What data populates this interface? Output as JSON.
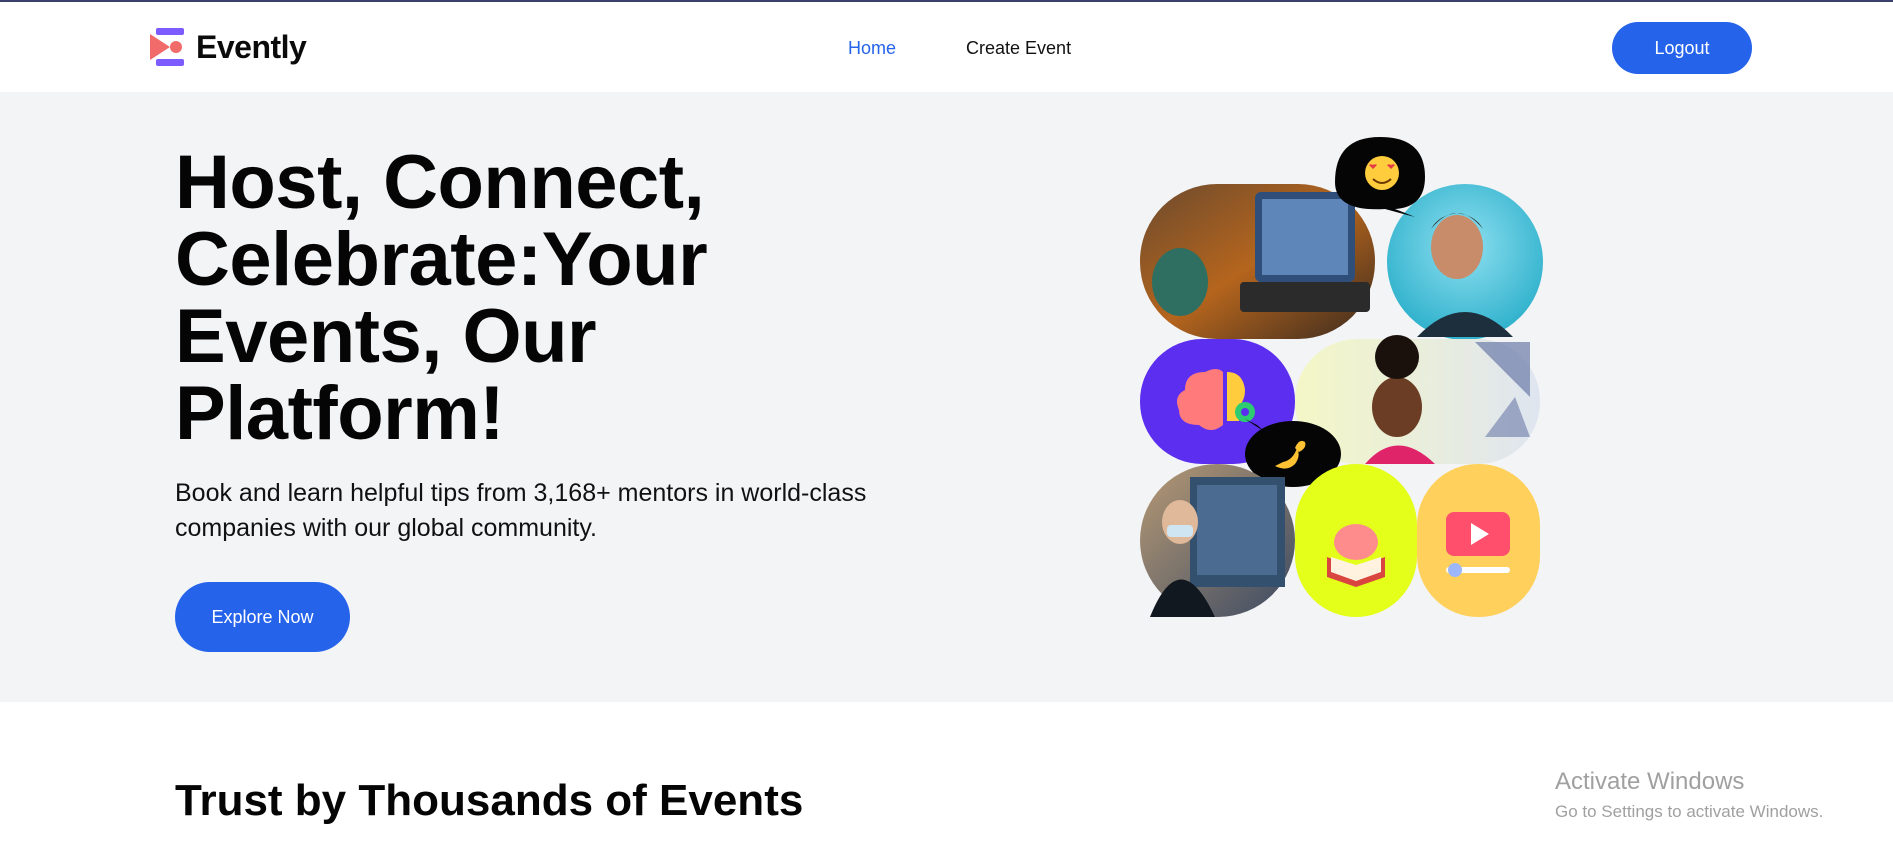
{
  "brand": {
    "name": "Evently",
    "colors": {
      "accent": "#2563eb",
      "logo_pink": "#f26b6b",
      "logo_purple": "#7c5cff"
    }
  },
  "nav": {
    "items": [
      {
        "label": "Home",
        "active": true
      },
      {
        "label": "Create Event",
        "active": false
      }
    ]
  },
  "header": {
    "logout_label": "Logout"
  },
  "hero": {
    "title": "Host, Connect, Celebrate:Your Events, Our Platform!",
    "subtitle": "Book and learn helpful tips from 3,168+ mentors in world-class companies with our global community.",
    "cta_label": "Explore Now",
    "collage_icons": [
      "heart-eyes-emoji",
      "brain-idea-icon",
      "pinch-hand-emoji",
      "book-brain-icon",
      "video-play-icon"
    ]
  },
  "section": {
    "title": "Trust by Thousands of Events"
  },
  "watermark": {
    "line1": "Activate Windows",
    "line2": "Go to Settings to activate Windows."
  }
}
